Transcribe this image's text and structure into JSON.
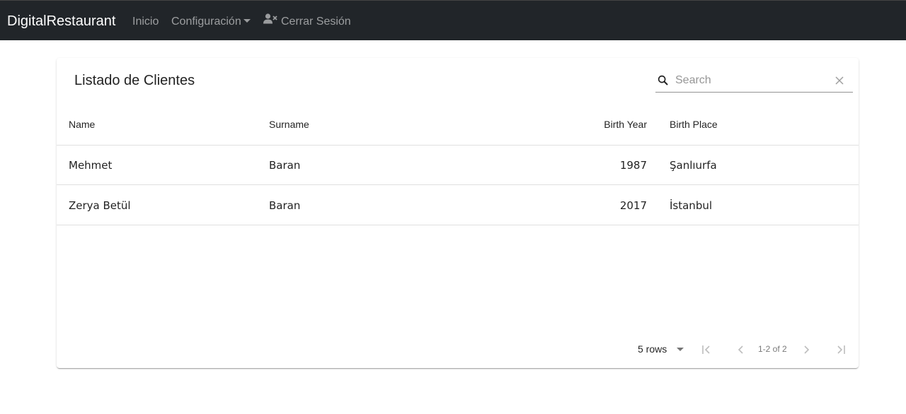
{
  "navbar": {
    "brand": "DigitalRestaurant",
    "links": {
      "home": "Inicio",
      "config": "Configuración",
      "logout": "Cerrar Sesión"
    }
  },
  "card": {
    "title": "Listado de Clientes",
    "search": {
      "placeholder": "Search",
      "value": ""
    }
  },
  "table": {
    "columns": [
      "Name",
      "Surname",
      "Birth Year",
      "Birth Place"
    ],
    "rows": [
      [
        "Mehmet",
        "Baran",
        "1987",
        "Şanlıurfa"
      ],
      [
        "Zerya Betül",
        "Baran",
        "2017",
        "İstanbul"
      ]
    ]
  },
  "pagination": {
    "rows_per_page": "5 rows",
    "range": "1-2 of 2"
  },
  "colors": {
    "navbar_bg": "#212529",
    "nav_text": "rgba(255,255,255,0.55)",
    "brand_text": "#ffffff"
  },
  "icons": {
    "logout": "user-times-icon",
    "search": "search-icon",
    "clear": "close-icon",
    "first": "first-page-icon",
    "prev": "chevron-left-icon",
    "next": "chevron-right-icon",
    "last": "last-page-icon"
  }
}
